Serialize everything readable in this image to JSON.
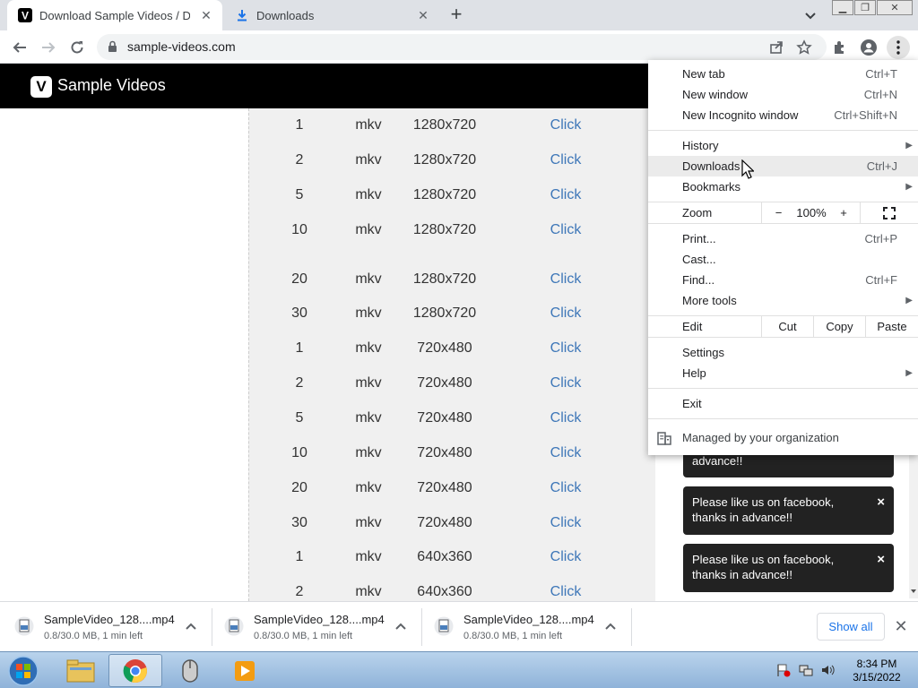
{
  "browser": {
    "tabs": [
      {
        "title": "Download Sample Videos / Dum",
        "favicon": "v-logo-icon",
        "active": true
      },
      {
        "title": "Downloads",
        "favicon": "download-icon",
        "active": false
      }
    ],
    "url": "sample-videos.com"
  },
  "site": {
    "logo_letter": "V",
    "name": "Sample Videos"
  },
  "table_rows": [
    {
      "size": "1",
      "format": "mkv",
      "resolution": "1280x720",
      "link": "Click"
    },
    {
      "size": "2",
      "format": "mkv",
      "resolution": "1280x720",
      "link": "Click"
    },
    {
      "size": "5",
      "format": "mkv",
      "resolution": "1280x720",
      "link": "Click"
    },
    {
      "size": "10",
      "format": "mkv",
      "resolution": "1280x720",
      "link": "Click"
    },
    {
      "size": "20",
      "format": "mkv",
      "resolution": "1280x720",
      "link": "Click"
    },
    {
      "size": "30",
      "format": "mkv",
      "resolution": "1280x720",
      "link": "Click"
    },
    {
      "size": "1",
      "format": "mkv",
      "resolution": "720x480",
      "link": "Click"
    },
    {
      "size": "2",
      "format": "mkv",
      "resolution": "720x480",
      "link": "Click"
    },
    {
      "size": "5",
      "format": "mkv",
      "resolution": "720x480",
      "link": "Click"
    },
    {
      "size": "10",
      "format": "mkv",
      "resolution": "720x480",
      "link": "Click"
    },
    {
      "size": "20",
      "format": "mkv",
      "resolution": "720x480",
      "link": "Click"
    },
    {
      "size": "30",
      "format": "mkv",
      "resolution": "720x480",
      "link": "Click"
    },
    {
      "size": "1",
      "format": "mkv",
      "resolution": "640x360",
      "link": "Click"
    },
    {
      "size": "2",
      "format": "mkv",
      "resolution": "640x360",
      "link": "Click"
    }
  ],
  "notifications": [
    {
      "text": "advance!!"
    },
    {
      "text": "Please like us on facebook, thanks in advance!!",
      "close": "×"
    },
    {
      "text": "Please like us on facebook, thanks in advance!!",
      "close": "×"
    }
  ],
  "menu": {
    "new_tab": {
      "label": "New tab",
      "shortcut": "Ctrl+T"
    },
    "new_window": {
      "label": "New window",
      "shortcut": "Ctrl+N"
    },
    "new_incognito": {
      "label": "New Incognito window",
      "shortcut": "Ctrl+Shift+N"
    },
    "history": {
      "label": "History"
    },
    "downloads": {
      "label": "Downloads",
      "shortcut": "Ctrl+J"
    },
    "bookmarks": {
      "label": "Bookmarks"
    },
    "zoom": {
      "label": "Zoom",
      "minus": "−",
      "level": "100%",
      "plus": "+"
    },
    "print": {
      "label": "Print...",
      "shortcut": "Ctrl+P"
    },
    "cast": {
      "label": "Cast..."
    },
    "find": {
      "label": "Find...",
      "shortcut": "Ctrl+F"
    },
    "more_tools": {
      "label": "More tools"
    },
    "edit": {
      "label": "Edit",
      "cut": "Cut",
      "copy": "Copy",
      "paste": "Paste"
    },
    "settings": {
      "label": "Settings"
    },
    "help": {
      "label": "Help"
    },
    "exit": {
      "label": "Exit"
    },
    "managed": {
      "label": "Managed by your organization"
    }
  },
  "downloads": [
    {
      "filename": "SampleVideo_128....mp4",
      "status": "0.8/30.0 MB, 1 min left"
    },
    {
      "filename": "SampleVideo_128....mp4",
      "status": "0.8/30.0 MB, 1 min left"
    },
    {
      "filename": "SampleVideo_128....mp4",
      "status": "0.8/30.0 MB, 1 min left"
    }
  ],
  "download_bar": {
    "show_all": "Show all"
  },
  "taskbar": {
    "apps": [
      "file-explorer-icon",
      "chrome-icon",
      "mouse-icon",
      "media-player-icon"
    ],
    "time": "8:34 PM",
    "date": "3/15/2022"
  }
}
